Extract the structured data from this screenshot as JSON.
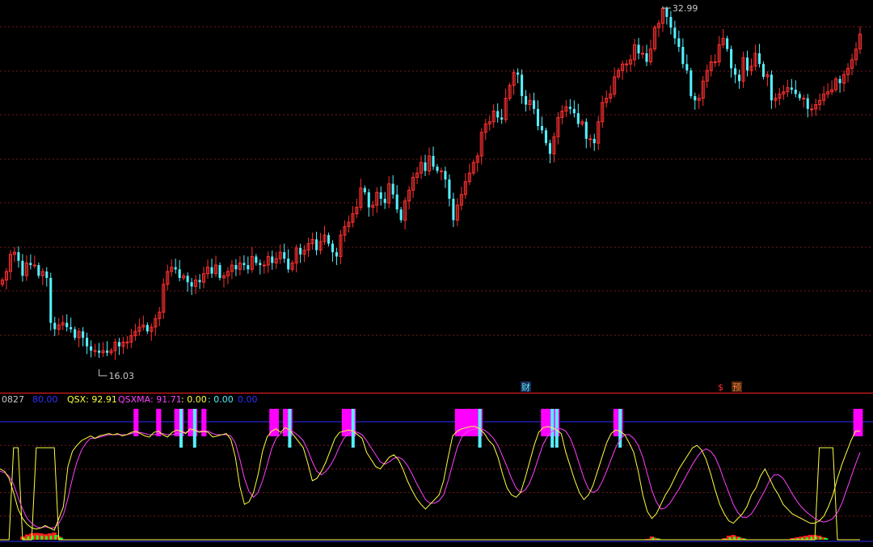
{
  "colors": {
    "background": "#000000",
    "up_candle": "#ff3030",
    "down_candle": "#54f0ff",
    "grid": "#7a1a1a",
    "separator": "#ff2020",
    "qsx_line": "#ffff40",
    "qsxma_line": "#ff40ff",
    "boundary_line": "#3030ff",
    "magenta_bar": "#ff00ff",
    "cyan_bar": "#54f0ff",
    "hist_red": "#ff2020",
    "hist_green": "#20ff20",
    "label_gray": "#c8c8c8"
  },
  "price_panel": {
    "high_marker": "32.99",
    "low_marker": "16.03",
    "event_markers": [
      {
        "text": "财",
        "color": "#54f0ff",
        "bg": "#1b2a55"
      },
      {
        "text": "$",
        "color": "#ff3030",
        "bg": ""
      },
      {
        "text": "预",
        "color": "#ff7a30",
        "bg": "#4a2a10"
      }
    ]
  },
  "indicator_header": {
    "code": "0827",
    "level": "80.00",
    "qsx_label": "QSX: 92.91",
    "qsxma_label": "QSXMA: 91.71",
    "extra1": ": 0.00",
    "extra2": ": 0.00",
    "extra3": "0.00"
  },
  "chart_data": [
    {
      "type": "candlestick",
      "title": "",
      "ylim": [
        16.03,
        32.99
      ],
      "series": [
        {
          "name": "",
          "values": [
            20.2,
            20.6,
            21.4,
            21.5,
            21.1,
            20.4,
            21.0,
            20.9,
            20.9,
            20.4,
            20.6,
            20.3,
            18.2,
            17.9,
            18.1,
            18.2,
            18.0,
            17.9,
            17.5,
            17.8,
            17.5,
            17.1,
            16.9,
            16.9,
            16.8,
            16.9,
            16.8,
            16.9,
            17.3,
            17.1,
            17.3,
            17.3,
            17.6,
            17.8,
            18.0,
            18.1,
            17.8,
            18.0,
            18.4,
            18.7,
            20.0,
            20.6,
            20.8,
            20.7,
            20.3,
            20.4,
            20.1,
            19.9,
            20.2,
            20.1,
            20.5,
            20.8,
            20.5,
            20.9,
            20.3,
            20.4,
            20.6,
            20.9,
            20.7,
            21.0,
            20.9,
            20.7,
            21.3,
            21.0,
            20.9,
            20.9,
            21.3,
            21.0,
            21.2,
            21.5,
            21.2,
            20.7,
            21.0,
            21.7,
            21.4,
            21.6,
            21.9,
            22.1,
            21.6,
            22.0,
            22.3,
            21.9,
            21.5,
            21.3,
            22.3,
            22.7,
            22.9,
            23.3,
            23.6,
            24.5,
            24.3,
            23.6,
            23.7,
            24.3,
            24.0,
            23.8,
            24.7,
            24.2,
            23.5,
            23.0,
            23.9,
            24.4,
            25.0,
            25.2,
            25.7,
            25.3,
            26.0,
            25.5,
            25.3,
            25.3,
            24.9,
            24.0,
            23.0,
            23.7,
            24.2,
            24.8,
            25.2,
            25.7,
            26.0,
            27.1,
            27.5,
            27.6,
            28.1,
            27.8,
            27.7,
            28.7,
            29.3,
            29.9,
            29.8,
            28.8,
            28.4,
            28.6,
            28.2,
            27.4,
            27.2,
            26.6,
            26.1,
            26.9,
            27.8,
            28.1,
            28.3,
            28.2,
            28.0,
            27.5,
            27.6,
            26.8,
            26.8,
            26.6,
            27.6,
            28.5,
            28.7,
            28.9,
            29.7,
            30.0,
            30.3,
            30.3,
            30.5,
            31.2,
            30.8,
            30.8,
            30.4,
            31.0,
            32.0,
            32.2,
            32.9,
            32.5,
            32.0,
            31.5,
            31.1,
            30.3,
            30.0,
            28.8,
            28.6,
            28.7,
            29.5,
            30.0,
            30.4,
            30.4,
            31.2,
            31.5,
            31.0,
            30.1,
            29.8,
            29.5,
            30.6,
            30.0,
            30.2,
            30.8,
            30.3,
            29.7,
            29.8,
            28.6,
            28.7,
            28.9,
            29.0,
            29.2,
            29.1,
            28.9,
            28.7,
            28.7,
            28.2,
            28.2,
            28.4,
            28.6,
            28.9,
            29.0,
            29.1,
            29.6,
            29.4,
            29.8,
            30.1,
            30.5,
            31.0,
            31.7
          ]
        }
      ]
    },
    {
      "type": "line",
      "title": "",
      "ylim": [
        0,
        100
      ],
      "series": [
        {
          "name": "QSX",
          "values": [
            60,
            58,
            52,
            40,
            26,
            18,
            13,
            10,
            9,
            10,
            12,
            10,
            8,
            18,
            28,
            62,
            75,
            80,
            84,
            86,
            88,
            86,
            88,
            89,
            90,
            89,
            90,
            88,
            89,
            91,
            92,
            90,
            88,
            87,
            91,
            92,
            89,
            87,
            91,
            93,
            92,
            90,
            94,
            93,
            91,
            92,
            91,
            87,
            88,
            89,
            90,
            85,
            70,
            45,
            30,
            32,
            40,
            55,
            75,
            87,
            92,
            94,
            91,
            95,
            93,
            88,
            83,
            78,
            65,
            50,
            52,
            58,
            66,
            76,
            86,
            91,
            92,
            93,
            92,
            89,
            86,
            74,
            68,
            62,
            60,
            65,
            70,
            72,
            68,
            60,
            50,
            42,
            35,
            30,
            26,
            30,
            34,
            38,
            50,
            70,
            88,
            92,
            94,
            95,
            96,
            96,
            94,
            90,
            84,
            80,
            70,
            56,
            44,
            38,
            36,
            40,
            52,
            66,
            80,
            91,
            95,
            96,
            95,
            93,
            90,
            74,
            62,
            50,
            40,
            34,
            38,
            46,
            58,
            70,
            82,
            90,
            93,
            92,
            89,
            82,
            74,
            58,
            38,
            24,
            18,
            22,
            30,
            38,
            44,
            52,
            60,
            66,
            72,
            78,
            80,
            76,
            68,
            56,
            42,
            30,
            22,
            16,
            14,
            18,
            22,
            28,
            38,
            44,
            54,
            60,
            52,
            44,
            38,
            30,
            26,
            22,
            20,
            18,
            16,
            14,
            14,
            16,
            20,
            28,
            38,
            52,
            64,
            74,
            84,
            92,
            92
          ]
        },
        {
          "name": "QSXMA",
          "values": [
            58,
            57,
            54,
            47,
            36,
            26,
            18,
            14,
            11,
            10,
            11,
            10,
            10,
            14,
            21,
            35,
            52,
            66,
            76,
            82,
            86,
            86,
            87,
            88,
            89,
            89,
            89,
            89,
            89,
            90,
            91,
            91,
            90,
            89,
            89,
            90,
            90,
            89,
            89,
            90,
            91,
            91,
            92,
            93,
            92,
            92,
            92,
            90,
            89,
            89,
            89,
            88,
            82,
            68,
            52,
            41,
            36,
            40,
            50,
            63,
            77,
            86,
            90,
            92,
            93,
            91,
            88,
            84,
            76,
            66,
            58,
            55,
            58,
            63,
            70,
            79,
            86,
            90,
            92,
            91,
            89,
            84,
            78,
            72,
            66,
            64,
            66,
            69,
            70,
            68,
            63,
            56,
            48,
            41,
            34,
            31,
            31,
            33,
            38,
            50,
            64,
            78,
            87,
            91,
            93,
            94,
            94,
            93,
            90,
            86,
            80,
            71,
            62,
            52,
            44,
            40,
            42,
            48,
            58,
            70,
            81,
            88,
            92,
            94,
            94,
            92,
            86,
            76,
            64,
            52,
            43,
            40,
            42,
            49,
            58,
            68,
            78,
            85,
            89,
            89,
            86,
            80,
            70,
            56,
            42,
            32,
            26,
            27,
            31,
            37,
            43,
            50,
            57,
            64,
            70,
            75,
            77,
            75,
            70,
            61,
            50,
            40,
            30,
            23,
            19,
            19,
            22,
            28,
            35,
            42,
            50,
            55,
            55,
            52,
            46,
            39,
            33,
            28,
            24,
            21,
            18,
            16,
            15,
            16,
            18,
            23,
            31,
            42,
            53,
            64,
            74,
            83
          ]
        },
        {
          "name": "",
          "values": [
            0,
            0,
            0,
            100,
            100,
            0,
            0,
            0,
            100,
            100,
            100,
            100,
            100,
            0,
            0,
            0,
            0,
            0,
            0,
            0,
            0,
            0,
            0,
            0,
            0,
            0,
            0,
            0,
            0,
            0,
            0,
            0,
            0,
            0,
            0,
            0,
            0,
            0,
            0,
            0,
            0,
            0,
            0,
            0,
            0,
            0,
            0,
            0,
            0,
            0,
            0,
            0,
            0,
            0,
            0,
            0,
            0,
            0,
            0,
            0,
            0,
            0,
            0,
            0,
            0,
            0,
            0,
            0,
            0,
            0,
            0,
            0,
            0,
            0,
            0,
            0,
            0,
            0,
            0,
            0,
            0,
            0,
            0,
            0,
            0,
            0,
            0,
            0,
            0,
            0,
            0,
            0,
            0,
            0,
            0,
            0,
            0,
            0,
            0,
            0,
            0,
            0,
            0,
            0,
            0,
            0,
            0,
            0,
            0,
            0,
            0,
            0,
            0,
            0,
            0,
            0,
            0,
            0,
            0,
            0,
            0,
            0,
            0,
            0,
            0,
            0,
            0,
            0,
            0,
            0,
            0,
            0,
            0,
            0,
            0,
            0,
            0,
            0,
            0,
            0,
            0,
            0,
            0,
            0,
            0,
            0,
            0,
            0,
            0,
            0,
            0,
            0,
            0,
            0,
            0,
            0,
            0,
            0,
            0,
            0,
            0,
            0,
            0,
            0,
            0,
            0,
            0,
            0,
            0,
            0,
            0,
            0,
            0,
            0,
            0,
            0,
            0,
            0,
            0,
            0,
            0,
            100,
            100,
            100,
            100,
            0,
            0,
            0,
            0,
            0,
            0,
            0,
            0,
            0,
            0,
            0,
            0
          ]
        }
      ]
    }
  ]
}
